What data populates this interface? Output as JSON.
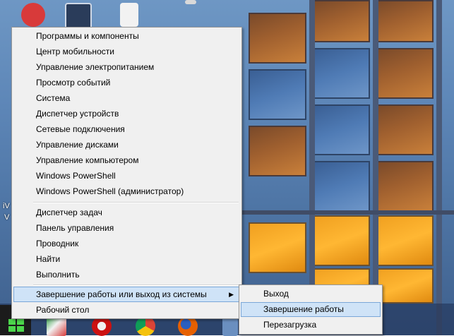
{
  "context_menu": {
    "group1": [
      "Программы и компоненты",
      "Центр мобильности",
      "Управление электропитанием",
      "Просмотр событий",
      "Система",
      "Диспетчер устройств",
      "Сетевые подключения",
      "Управление дисками",
      "Управление компьютером",
      "Windows PowerShell",
      "Windows PowerShell (администратор)"
    ],
    "group2": [
      "Диспетчер задач",
      "Панель управления",
      "Проводник",
      "Найти",
      "Выполнить"
    ],
    "shutdown_label": "Завершение работы или выход из системы",
    "shutdown_arrow": "▶",
    "desktop_label": "Рабочий стол"
  },
  "submenu": {
    "items": [
      "Выход",
      "Завершение работы",
      "Перезагрузка"
    ],
    "active_index": 1
  },
  "desktop": {
    "icon_text_1": "iV",
    "icon_text_2": "V"
  },
  "taskbar": {
    "icons": [
      "start-icon",
      "calendar-app-icon",
      "opera-icon",
      "chrome-icon",
      "firefox-icon",
      "app-icon"
    ]
  },
  "colors": {
    "menu_bg": "#f0f0f0",
    "highlight_bg": "#cfe3f7",
    "highlight_border": "#7aa7d8",
    "start_logo": "#4cd64c"
  }
}
